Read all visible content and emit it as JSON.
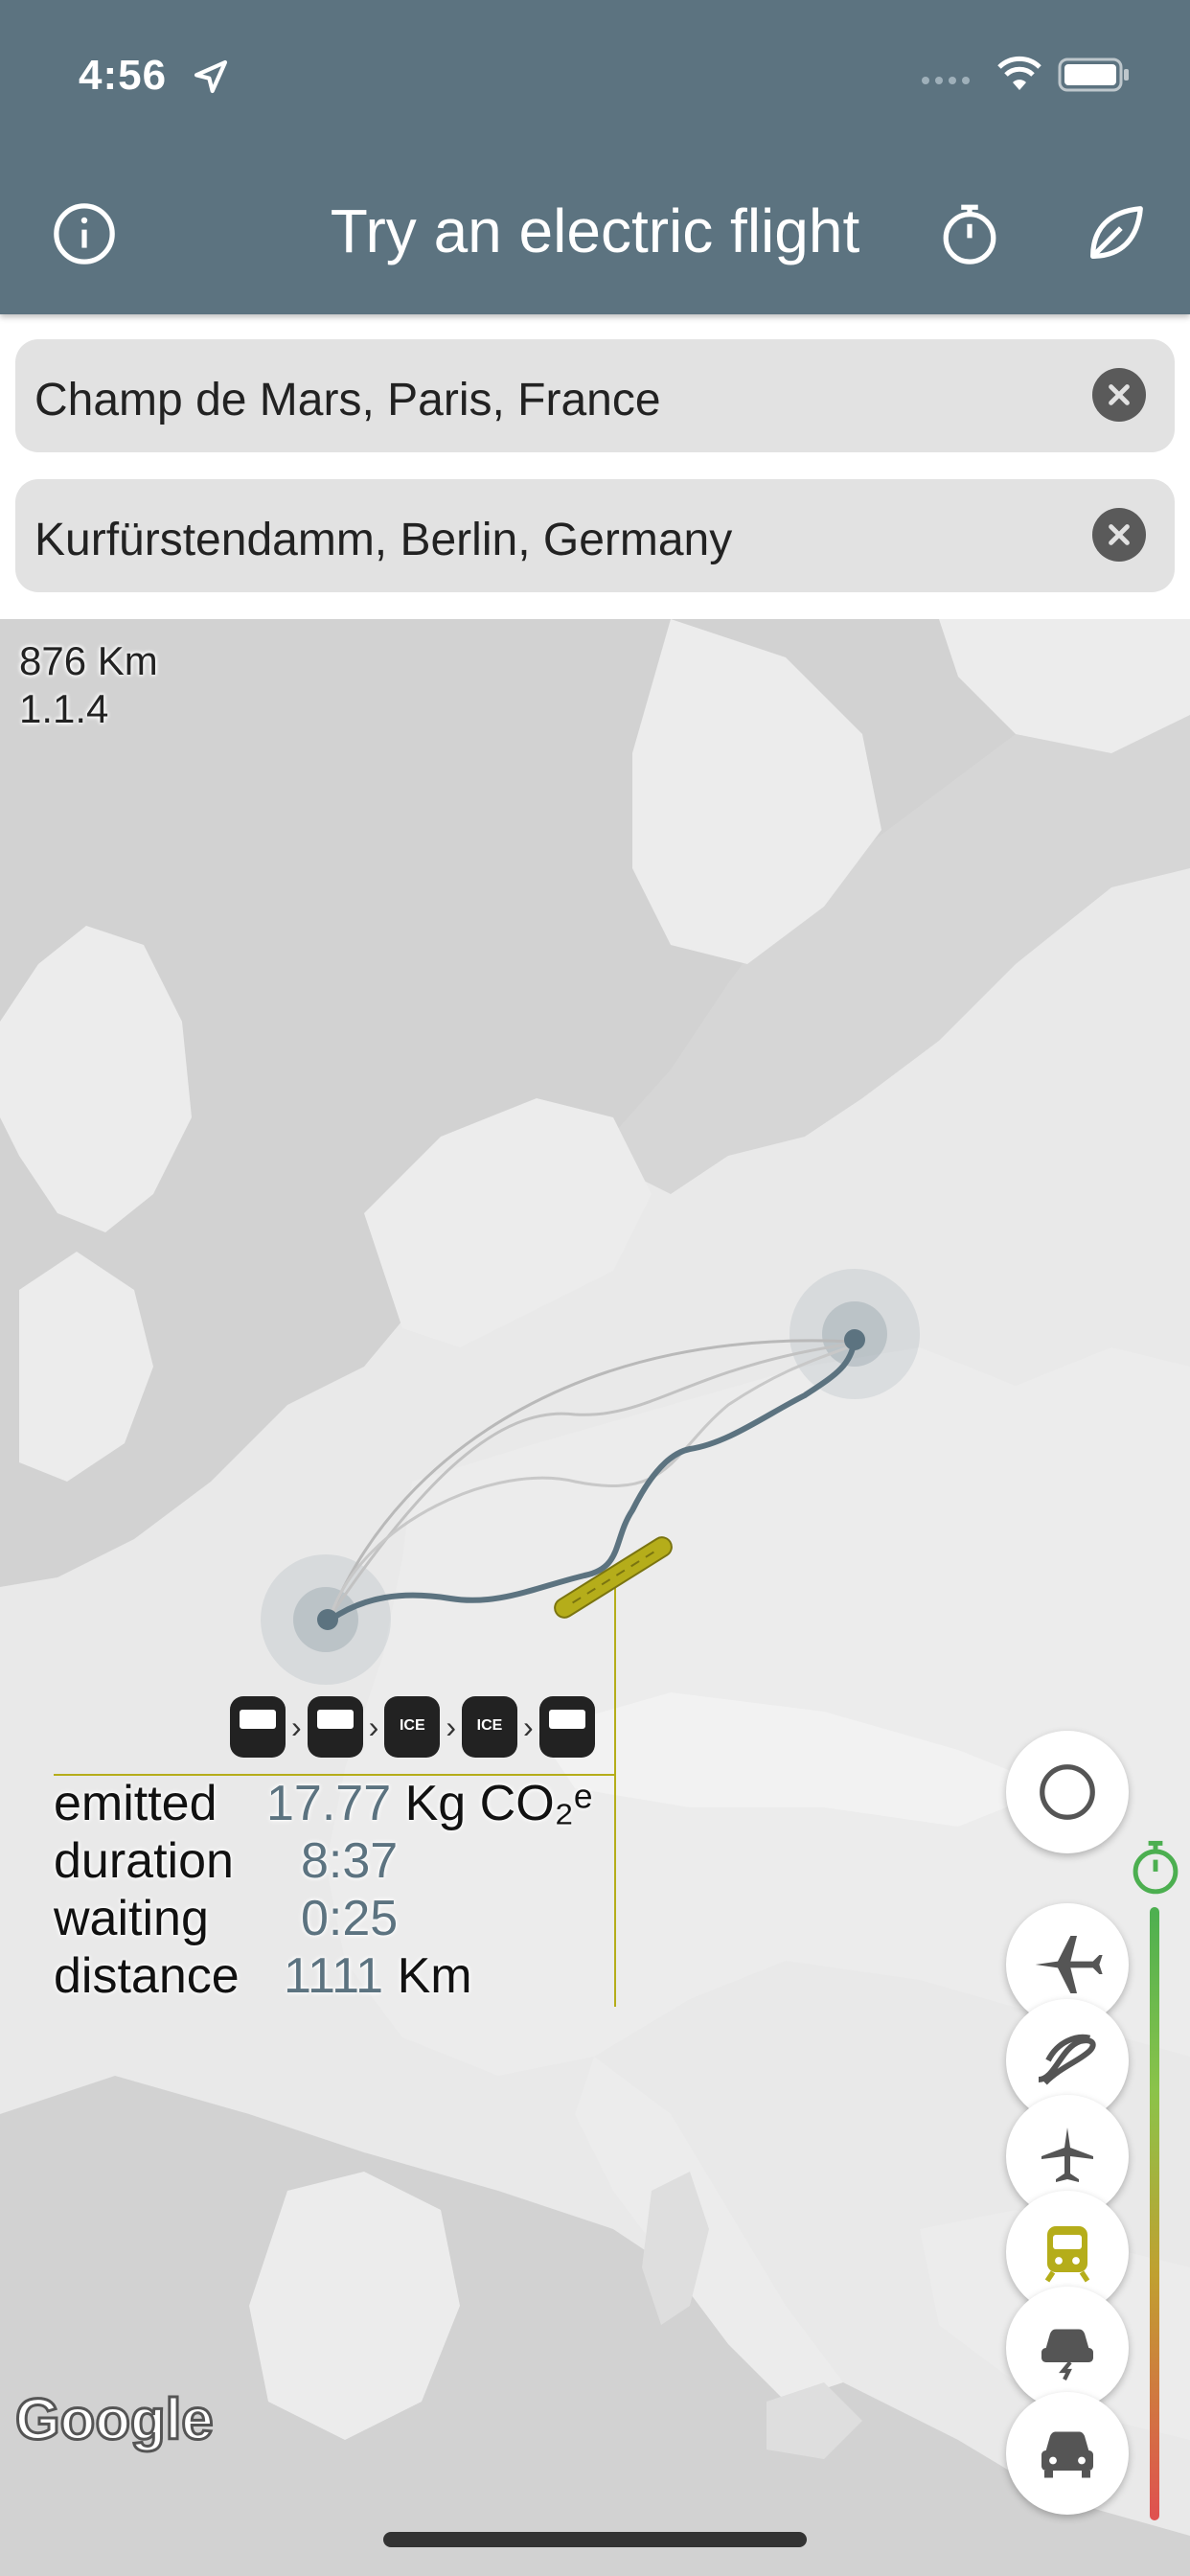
{
  "status_bar": {
    "time": "4:56"
  },
  "header": {
    "title": "Try an electric flight",
    "info_icon": "info-circle-icon",
    "stopwatch_icon": "stopwatch-icon",
    "leaf_icon": "leaf-icon",
    "background_color": "#5c7380"
  },
  "search": {
    "origin_value": "Champ de Mars, Paris, France",
    "destination_value": "Kurfürstendamm, Berlin, Germany"
  },
  "map": {
    "distance_label": "876 Km",
    "version_label": "1.1.4",
    "provider": "Google",
    "route_color": "#5c7380",
    "train_color": "#b5ad1a"
  },
  "trip_info": {
    "legs": [
      "train",
      "train",
      "ICE",
      "ICE",
      "train"
    ],
    "emitted_label": "emitted",
    "emitted_value": "17.77",
    "emitted_unit": "Kg CO₂ᵉ",
    "duration_label": "duration",
    "duration_value": "8:37",
    "waiting_label": "waiting",
    "waiting_value": "0:25",
    "distance_label": "distance",
    "distance_value": "1111",
    "distance_unit": "Km"
  },
  "transport_modes": [
    "circle",
    "plane",
    "electric-plane",
    "small-plane",
    "train",
    "electric-car",
    "car"
  ],
  "selected_mode": "train"
}
